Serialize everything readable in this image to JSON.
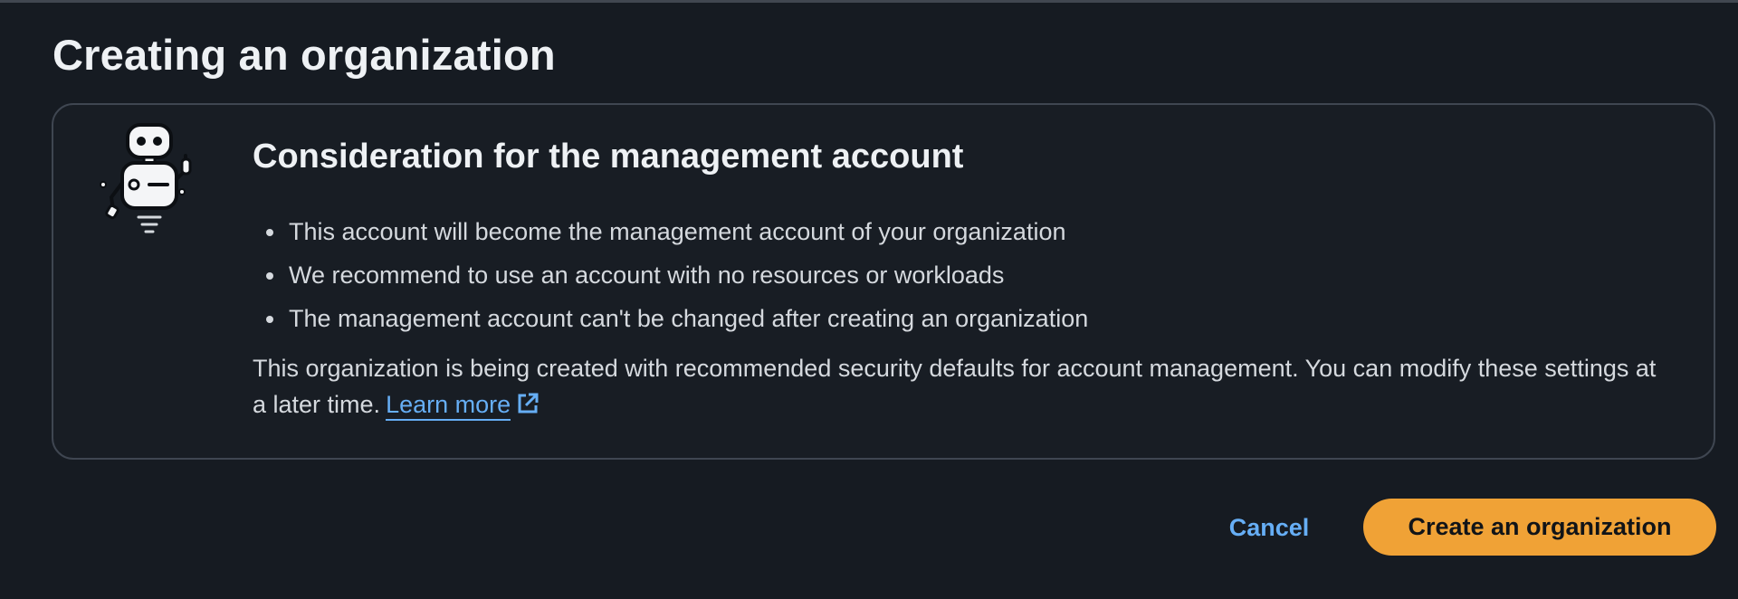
{
  "page": {
    "title": "Creating an organization"
  },
  "panel": {
    "heading": "Consideration for the management account",
    "illustration": "robot-icon",
    "bullets": [
      "This account will become the management account of your organization",
      "We recommend to use an account with no resources or workloads",
      "The management account can't be changed after creating an organization"
    ],
    "note": "This organization is being created with recommended security defaults for account management. You can modify these settings at a later time.",
    "learn_more_label": "Learn more",
    "learn_more_icon": "external-link-icon"
  },
  "actions": {
    "cancel_label": "Cancel",
    "create_label": "Create an organization"
  },
  "colors": {
    "background": "#161b22",
    "link": "#66aef5",
    "primary_button": "#f0a236",
    "panel_border": "#3f4651"
  }
}
